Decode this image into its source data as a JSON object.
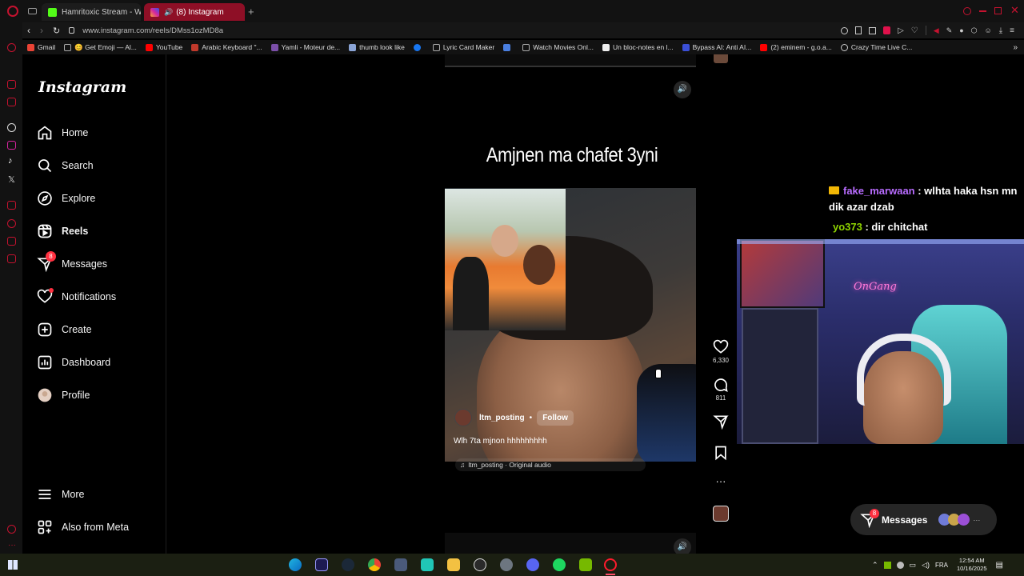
{
  "browser": {
    "tabs": [
      {
        "label": "Hamritoxic Stream - Watc"
      },
      {
        "label": "(8) Instagram"
      }
    ],
    "url": "www.instagram.com/reels/DMss1ozMD8a",
    "bookmarks": [
      "Gmail",
      "😊 Get Emoji — Al...",
      "YouTube",
      "Arabic Keyboard \"...",
      "Yamli - Moteur de...",
      "thumb look like",
      "Lyric Card Maker",
      "Watch Movies Onl...",
      "Un bloc-notes en l...",
      "Bypass AI: Anti AI...",
      "(2) eminem - g.o.a...",
      "Crazy Time Live C..."
    ]
  },
  "instagram": {
    "logo": "Instagram",
    "nav": [
      {
        "label": "Home",
        "icon": "home-icon"
      },
      {
        "label": "Search",
        "icon": "search-icon"
      },
      {
        "label": "Explore",
        "icon": "compass-icon"
      },
      {
        "label": "Reels",
        "icon": "reels-icon"
      },
      {
        "label": "Messages",
        "icon": "messenger-icon",
        "badge": "8"
      },
      {
        "label": "Notifications",
        "icon": "heart-icon"
      },
      {
        "label": "Create",
        "icon": "plus-square-icon"
      },
      {
        "label": "Dashboard",
        "icon": "dashboard-icon"
      },
      {
        "label": "Profile",
        "icon": "avatar"
      }
    ],
    "bottom_nav": [
      {
        "label": "More",
        "icon": "menu-icon"
      },
      {
        "label": "Also from Meta",
        "icon": "meta-icon"
      }
    ]
  },
  "reel": {
    "overlay_title": "Amjnen ma chafet 3yni",
    "username": "ltm_posting",
    "separator": "•",
    "follow_label": "Follow",
    "caption": "Wlh 7ta mjnon hhhhhhhhh",
    "audio": "ltm_posting · Original audio",
    "likes": "6,330",
    "comments": "811"
  },
  "stream_chat": [
    {
      "user": "fake_marwaan",
      "text": " : wlhta haka hsn mn dik azar dzab",
      "user_color": "#b86cff"
    },
    {
      "user": "yo373",
      "text": " : dir chitchat",
      "user_color": "#8fd400"
    }
  ],
  "webcam_sign": "OnGang",
  "messages_pill": {
    "label": "Messages",
    "badge": "8"
  },
  "taskbar": {
    "lang": "FRA",
    "time": "12:54 AM",
    "date": "10/16/2025"
  },
  "colors": {
    "accent": "#c4122f",
    "badge": "#ff3040",
    "follow_bg": "rgba(255,255,255,0.18)"
  }
}
